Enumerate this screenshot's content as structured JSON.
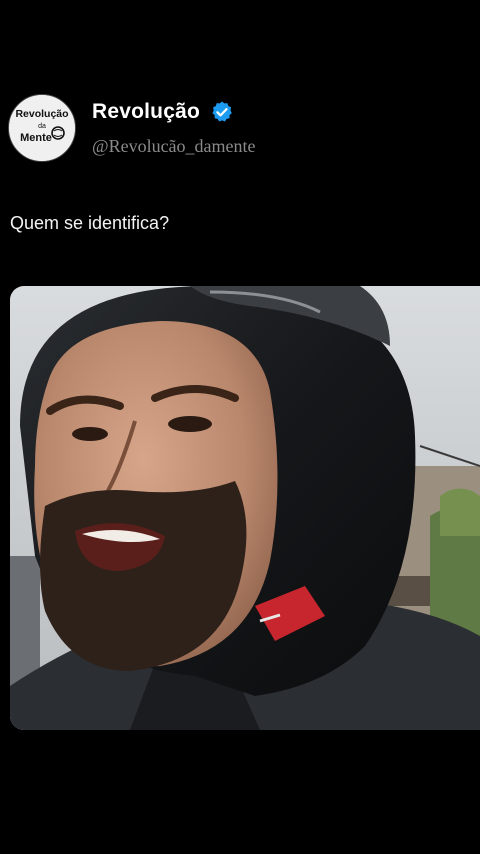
{
  "post": {
    "author_name": "Revolução",
    "handle": "@Revolucão_damente",
    "text": "Quem se identifica?",
    "verified": true,
    "verified_color": "#1d9bf0",
    "avatar_logo": {
      "line1": "Revolução",
      "line2": "da",
      "line3": "Mente"
    }
  },
  "media": {
    "type": "video-frame",
    "subject": "man-in-motorcycle-helmet"
  },
  "colors": {
    "background": "#000000",
    "text": "#ffffff",
    "handle": "#8a8a8a"
  }
}
